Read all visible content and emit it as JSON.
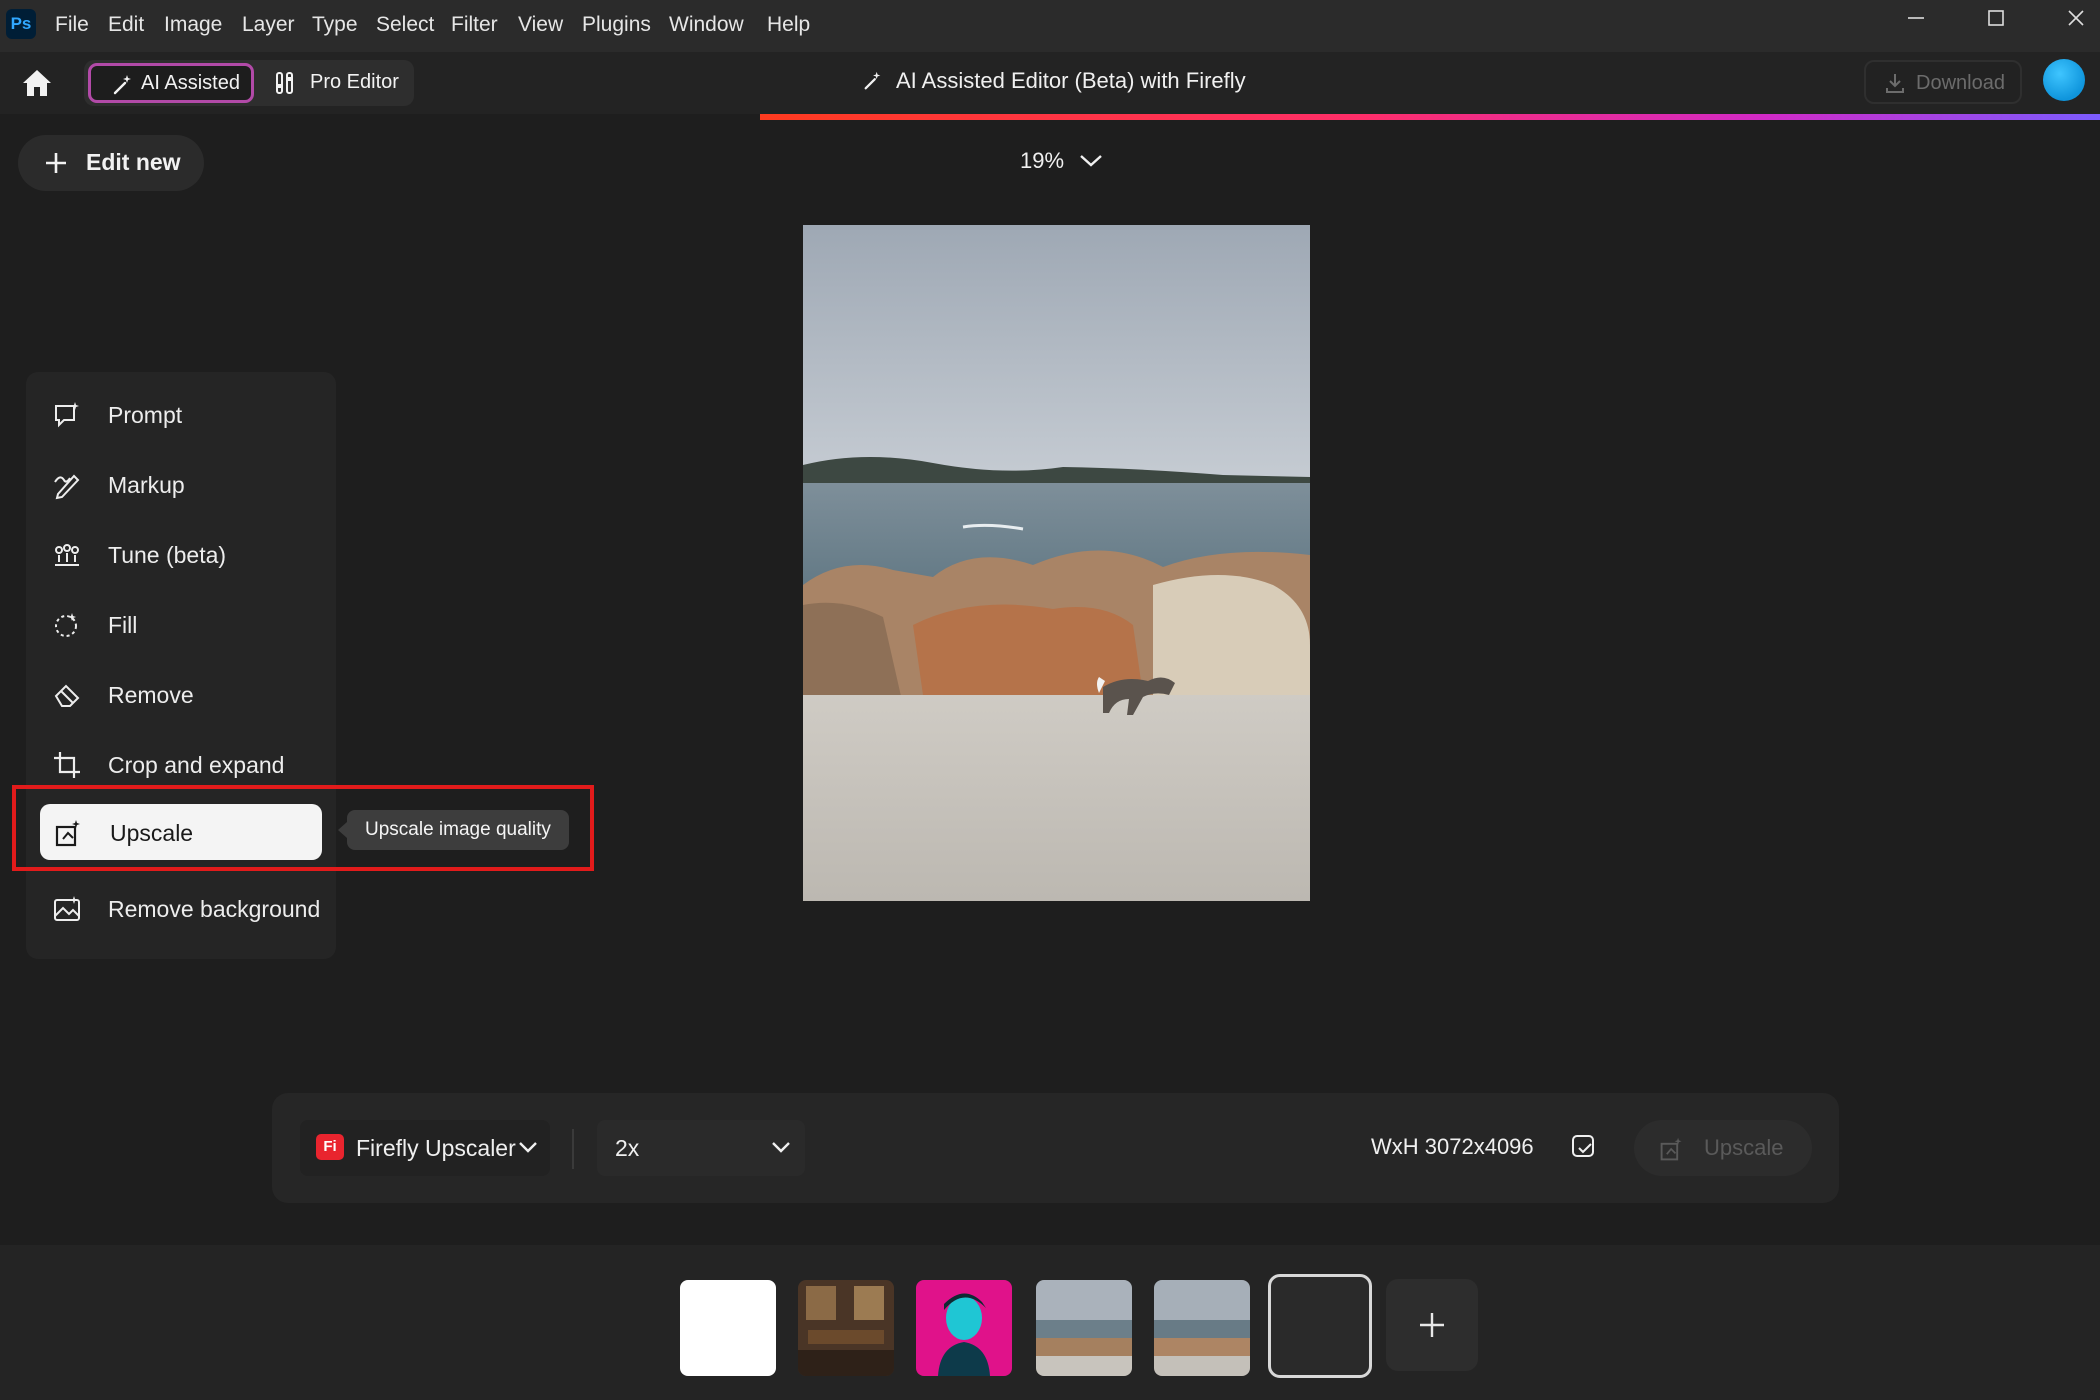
{
  "menubar": {
    "logo": "Ps",
    "items": [
      "File",
      "Edit",
      "Image",
      "Layer",
      "Type",
      "Select",
      "Filter",
      "View",
      "Plugins",
      "Window",
      "Help"
    ]
  },
  "toolbar": {
    "modes": [
      {
        "label": "AI Assisted",
        "active": true
      },
      {
        "label": "Pro Editor",
        "active": false
      }
    ],
    "title": "AI Assisted Editor (Beta) with Firefly",
    "download_label": "Download"
  },
  "edit_new_label": "Edit new",
  "zoom": "19%",
  "tools": [
    {
      "label": "Prompt",
      "icon": "prompt-icon",
      "active": false
    },
    {
      "label": "Markup",
      "icon": "markup-icon",
      "active": false
    },
    {
      "label": "Tune (beta)",
      "icon": "tune-icon",
      "active": false
    },
    {
      "label": "Fill",
      "icon": "fill-icon",
      "active": false
    },
    {
      "label": "Remove",
      "icon": "remove-icon",
      "active": false
    },
    {
      "label": "Crop and expand",
      "icon": "crop-icon",
      "active": true
    },
    {
      "label": "Upscale",
      "icon": "upscale-icon",
      "active": true
    },
    {
      "label": "Remove background",
      "icon": "remove-background-icon",
      "active": false
    }
  ],
  "tooltip": "Upscale image quality",
  "options": {
    "model_badge": "Fi",
    "model": "Firefly Upscaler",
    "scale": "2x",
    "dimensions": "WxH 3072x4096",
    "upscale_label": "Upscale"
  },
  "colors": {
    "accent_border": "#b24aa8",
    "highlight": "#e21b1b",
    "brand_firefly": "#e9242e",
    "avatar": "#1aa6ee"
  }
}
